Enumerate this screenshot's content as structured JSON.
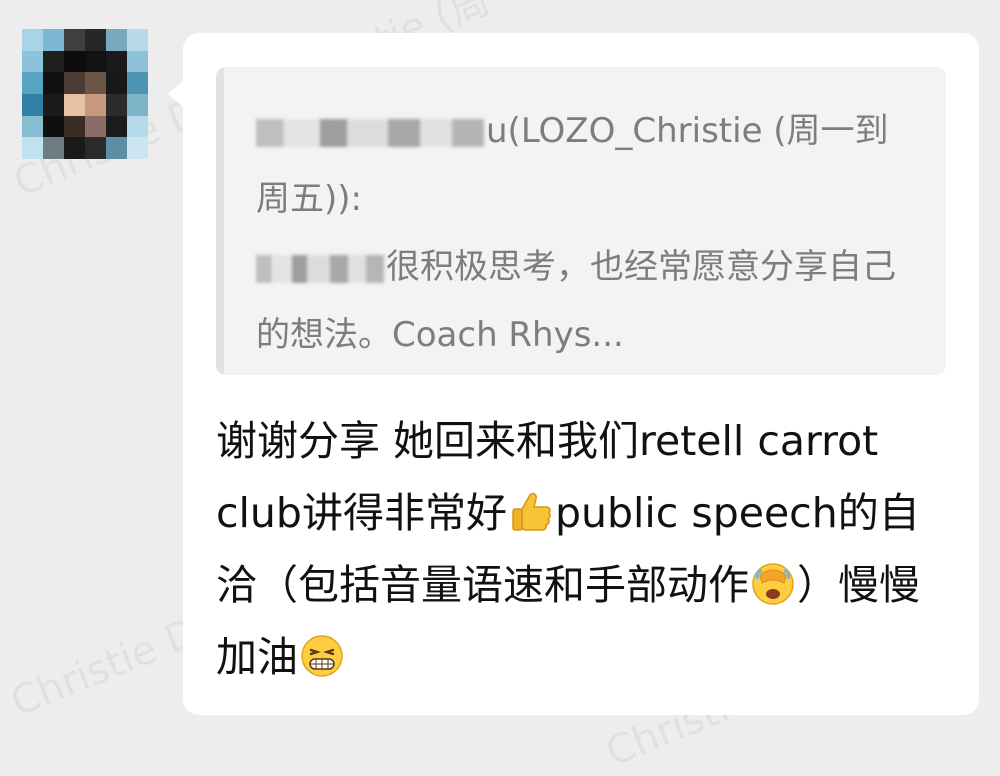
{
  "watermark": {
    "text": "Christie Du"
  },
  "watermark_top": {
    "text": "istie (周"
  },
  "avatar": {
    "icon": "pixelated-avatar-icon"
  },
  "quote": {
    "sender_suffix": "u(LOZO_Christie (周一到周五)):",
    "line_prefix_blurred": true,
    "content": "很积极思考，也经常愿意分享自己的想法。Coach Rhys..."
  },
  "message": {
    "part1": "谢谢分享 她回来和我们retell carrot club讲得非常好",
    "emoji1": "thumbs-up-icon",
    "part2": "public speech的自洽（包括音量语速和手部动作",
    "emoji2": "facepalm-icon",
    "part3": "）慢慢加油",
    "emoji3": "grinning-squint-icon"
  },
  "colors": {
    "background": "#ededed",
    "bubble": "#ffffff",
    "quote_background": "#f3f3f3",
    "quote_text": "#7d7d7d",
    "message_text": "#111111"
  }
}
